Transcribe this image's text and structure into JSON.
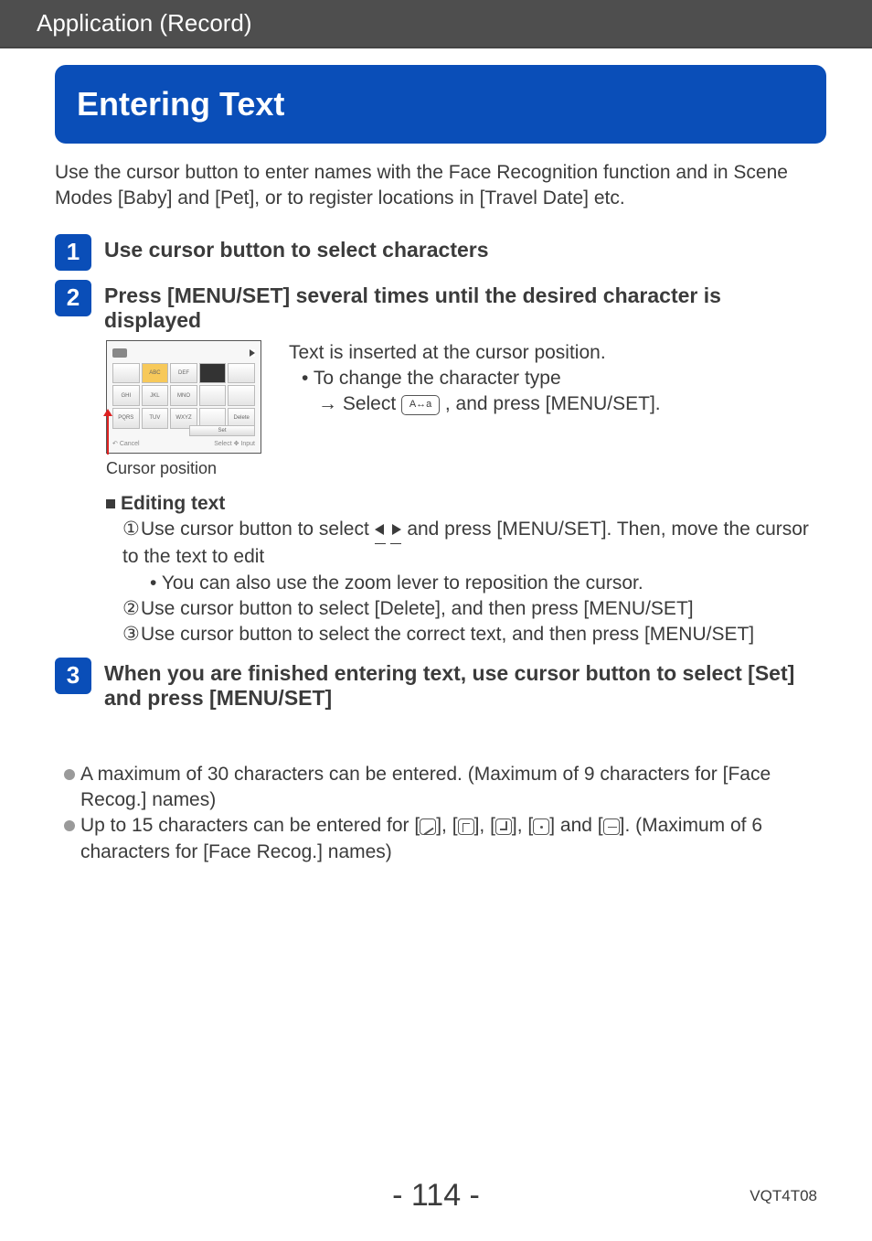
{
  "header": {
    "section": "Application (Record)"
  },
  "title": "Entering Text",
  "intro": "Use the cursor button to enter names with the Face Recognition function and in Scene Modes [Baby] and [Pet], or to register locations in [Travel Date] etc.",
  "steps": {
    "s1": {
      "num": "1",
      "title": "Use cursor button to select characters"
    },
    "s2": {
      "num": "2",
      "title": "Press [MENU/SET] several times until the desired character is displayed",
      "thumb": {
        "cells": [
          "",
          "ABC",
          "DEF",
          "",
          "",
          "GHI",
          "JKL",
          "MNO",
          "",
          "",
          "PQRS",
          "TUV",
          "WXYZ",
          "",
          "Delete"
        ],
        "set": "Set",
        "cancel": "Cancel",
        "select": "Select",
        "input": "Input"
      },
      "cursor_label": "Cursor position",
      "line1": "Text is inserted at the cursor position.",
      "line2": "To change the character type",
      "line3a": "→ Select ",
      "icon_label": "A↔a",
      "line3b": ", and press [MENU/SET]."
    },
    "s3": {
      "num": "3",
      "title": "When you are finished entering text, use cursor button to select [Set] and press [MENU/SET]"
    }
  },
  "editing": {
    "heading": "Editing text",
    "i1a": "Use cursor button to select ",
    "i1b": " and press [MENU/SET]. Then, move the cursor to the text to edit",
    "i1_sub": "You can also use the zoom lever to reposition the cursor.",
    "i2": "Use cursor button to select [Delete], and then press [MENU/SET]",
    "i3": "Use cursor button to select the correct text, and then press [MENU/SET]"
  },
  "notes": {
    "n1": "A maximum of 30 characters can be entered. (Maximum of 9 characters for [Face Recog.] names)",
    "n2a": "Up to 15 characters can be entered for [",
    "n2b": "], [",
    "n2c": "], [",
    "n2d": "], [",
    "n2e": "] and [",
    "n2f": "]. (Maximum of 6 characters for [Face Recog.] names)"
  },
  "footer": {
    "page": "- 114 -",
    "code": "VQT4T08"
  }
}
